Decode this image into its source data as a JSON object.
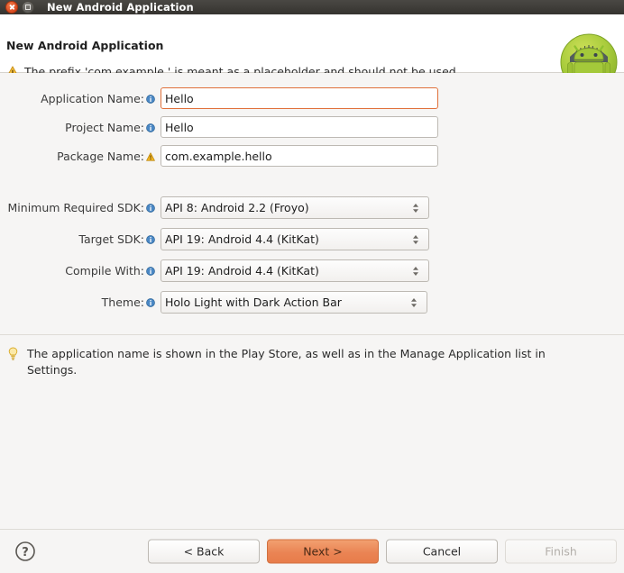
{
  "window": {
    "title": "New Android Application",
    "close_icon": "close-icon",
    "maximize_icon": "maximize-icon"
  },
  "header": {
    "title": "New Android Application",
    "warning_icon": "warning-triangle-icon",
    "message": "The prefix 'com.example.' is meant as a placeholder and should not be used",
    "logo_icon": "android-robot-logo"
  },
  "form": {
    "text_fields": [
      {
        "label": "Application Name:",
        "value": "Hello",
        "placeholder": "",
        "badge": "info-icon",
        "badge_kind": "info",
        "focused": true
      },
      {
        "label": "Project Name:",
        "value": "Hello",
        "placeholder": "",
        "badge": "info-icon",
        "badge_kind": "info",
        "focused": false
      },
      {
        "label": "Package Name:",
        "value": "com.example.hello",
        "placeholder": "",
        "badge": "warning-icon",
        "badge_kind": "warning",
        "focused": false
      }
    ],
    "combos": [
      {
        "label": "Minimum Required SDK:",
        "value": "API 8: Android 2.2 (Froyo)",
        "badge": "info-icon",
        "spinner": "spinner-updown-icon"
      },
      {
        "label": "Target SDK:",
        "value": "API 19: Android 4.4 (KitKat)",
        "badge": "info-icon",
        "spinner": "spinner-updown-icon"
      },
      {
        "label": "Compile With:",
        "value": "API 19: Android 4.4 (KitKat)",
        "badge": "info-icon",
        "spinner": "spinner-updown-icon"
      },
      {
        "label": "Theme:",
        "value": "Holo Light with Dark Action Bar",
        "badge": "info-icon",
        "spinner": "spinner-updown-icon"
      }
    ]
  },
  "tip": {
    "icon": "lightbulb-icon",
    "text": "The application name is shown in the Play Store, as well as in the Manage Application list in Settings."
  },
  "footer": {
    "help_icon": "help-question-icon",
    "back_label": "< Back",
    "next_label": "Next >",
    "cancel_label": "Cancel",
    "finish_label": "Finish",
    "finish_enabled": false
  },
  "colors": {
    "titlebar_bg": "#3c3b37",
    "accent_orange": "#e87c4a",
    "focus_border": "#e0703a",
    "android_green": "#a4c639",
    "info_blue": "#3a7fbf",
    "warning_amber": "#e8a317"
  }
}
